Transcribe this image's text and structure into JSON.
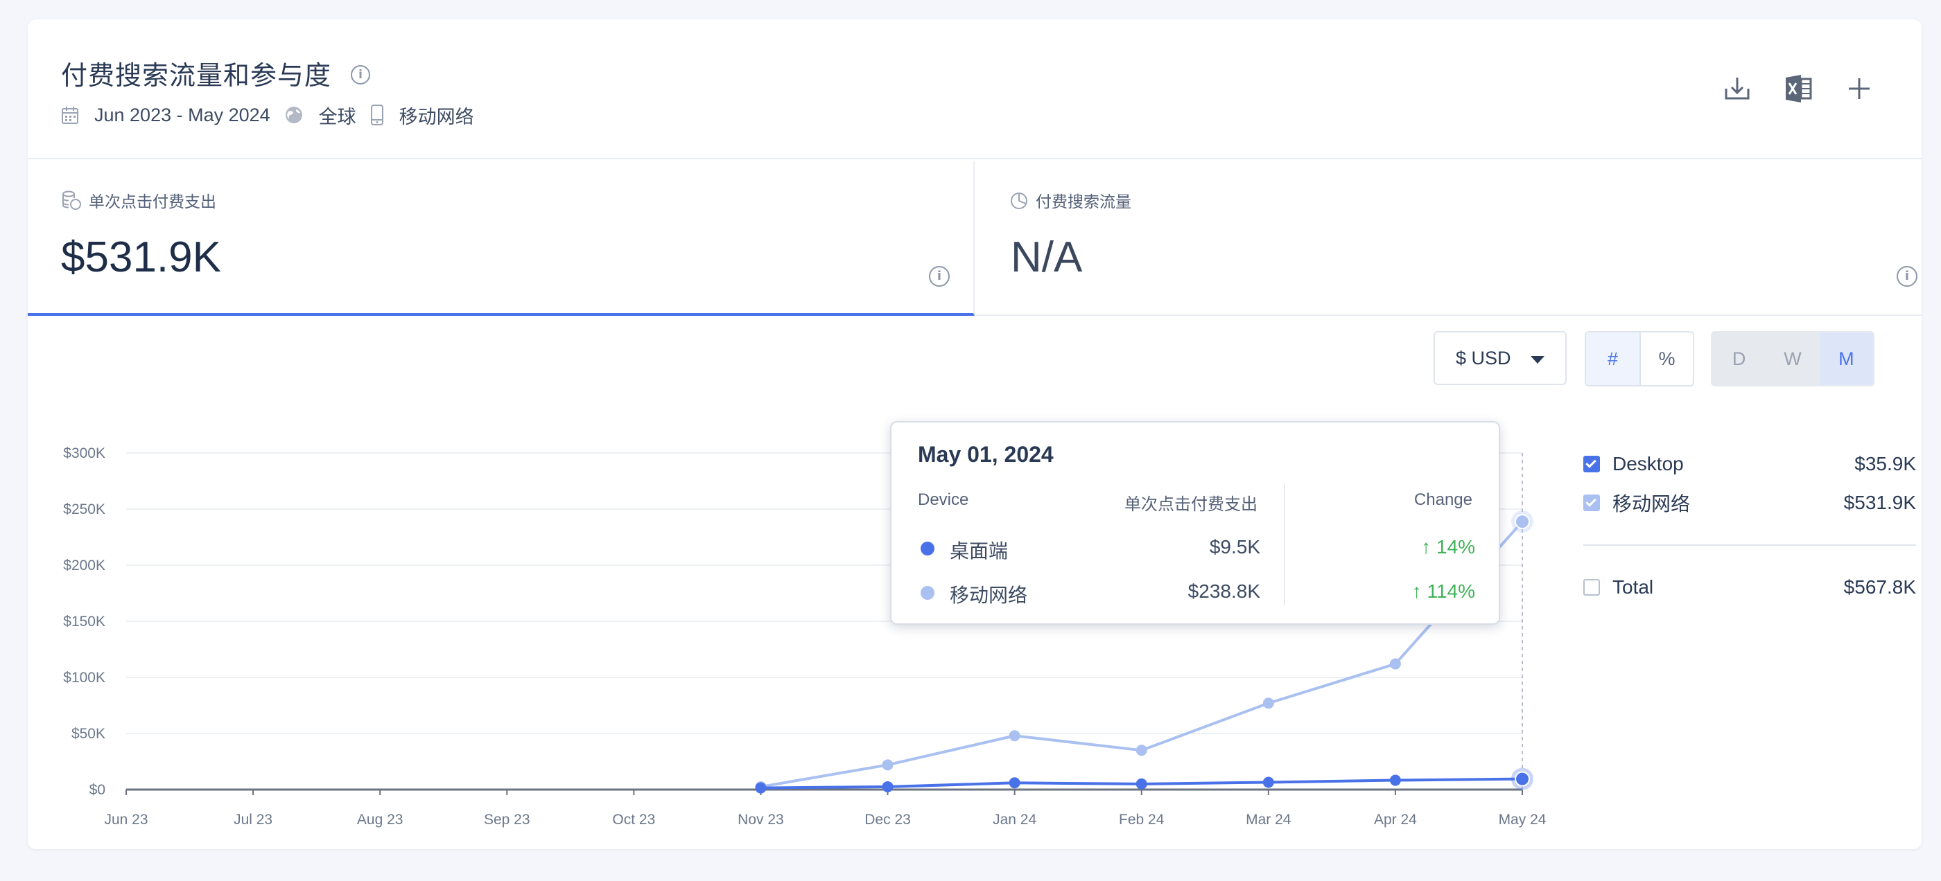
{
  "header": {
    "title": "付费搜索流量和参与度",
    "date_range": "Jun 2023 - May 2024",
    "region": "全球",
    "device": "移动网络"
  },
  "icons": {
    "title_info": "info-icon",
    "date": "calendar-icon",
    "region": "globe-icon",
    "device": "mobile-icon",
    "download": "download-icon",
    "excel": "excel-icon",
    "add": "plus-icon"
  },
  "metrics": [
    {
      "label": "单次点击付费支出",
      "value": "$531.9K"
    },
    {
      "label": "付费搜索流量",
      "value": "N/A"
    }
  ],
  "controls": {
    "currency": "$ USD",
    "format_options": [
      "#",
      "%"
    ],
    "format_selected": "#",
    "granularity_options": [
      "D",
      "W",
      "M"
    ],
    "granularity_selected": "M"
  },
  "chart_data": {
    "type": "line",
    "categories": [
      "Jun 23",
      "Jul 23",
      "Aug 23",
      "Sep 23",
      "Oct 23",
      "Nov 23",
      "Dec 23",
      "Jan 24",
      "Feb 24",
      "Mar 24",
      "Apr 24",
      "May 24"
    ],
    "y_ticks": [
      "$0",
      "$50K",
      "$100K",
      "$150K",
      "$200K",
      "$250K",
      "$300K"
    ],
    "ylim": [
      0,
      300000
    ],
    "grid": true,
    "series": [
      {
        "name": "Desktop",
        "color": "#4a72e8",
        "values": [
          0,
          0,
          0,
          0,
          0,
          1500,
          2500,
          6000,
          5000,
          6500,
          8300,
          9500
        ]
      },
      {
        "name": "移动网络",
        "color": "#a9c0f1",
        "values": [
          0,
          0,
          0,
          0,
          0,
          2500,
          22000,
          48000,
          35000,
          77000,
          112000,
          238800
        ]
      }
    ],
    "highlight_index": 11
  },
  "tooltip": {
    "date": "May 01, 2024",
    "col_device": "Device",
    "col_metric": "单次点击付费支出",
    "col_change": "Change",
    "rows": [
      {
        "name": "桌面端",
        "value": "$9.5K",
        "change": "14%",
        "color": "#4a72e8"
      },
      {
        "name": "移动网络",
        "value": "$238.8K",
        "change": "114%",
        "color": "#a9c0f1"
      }
    ]
  },
  "legend": {
    "items": [
      {
        "name": "Desktop",
        "value": "$35.9K",
        "checked": true
      },
      {
        "name": "移动网络",
        "value": "$531.9K",
        "checked": true
      }
    ],
    "total": {
      "name": "Total",
      "value": "$567.8K",
      "checked": false
    }
  }
}
